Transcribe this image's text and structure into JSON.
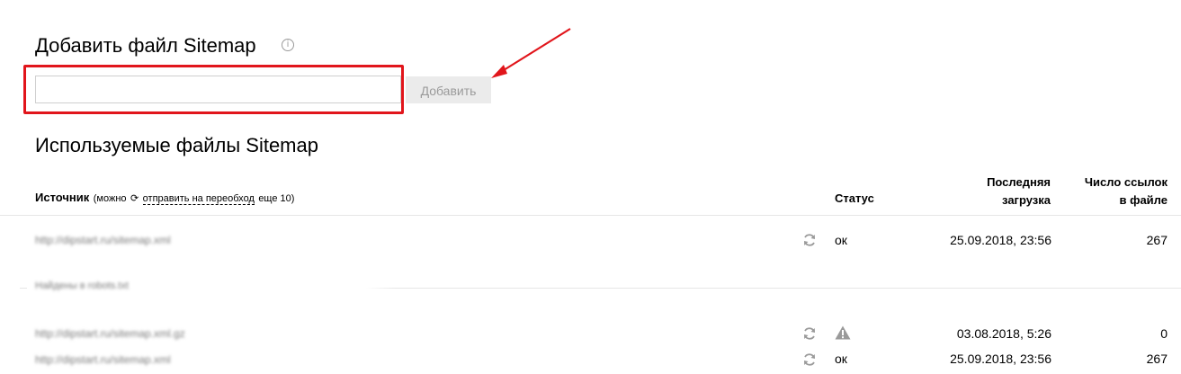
{
  "add_section": {
    "title": "Добавить файл Sitemap",
    "info_icon": "info-icon",
    "input_value": "",
    "add_button_label": "Добавить",
    "highlight_color": "#e1151b"
  },
  "used_section": {
    "title": "Используемые файлы Sitemap"
  },
  "table": {
    "headers": {
      "source": "Источник",
      "source_note_prefix": "(можно",
      "recrawl_link": "отправить на переобход",
      "source_note_suffix": "еще 10)",
      "status": "Статус",
      "last_load_line1": "Последняя",
      "last_load_line2": "загрузка",
      "links_count_line1": "Число ссылок",
      "links_count_line2": "в файле"
    },
    "rows": [
      {
        "url": "http://dipstart.ru/sitemap.xml",
        "status": "ок",
        "date": "25.09.2018, 23:56",
        "count": "267"
      }
    ],
    "robots_group": {
      "label": "Найдены в robots.txt",
      "rows": [
        {
          "url": "http://dipstart.ru/sitemap.xml.gz",
          "status_icon": "warning-icon",
          "date": "03.08.2018, 5:26",
          "count": "0"
        },
        {
          "url": "http://dipstart.ru/sitemap.xml",
          "status": "ок",
          "date": "25.09.2018, 23:56",
          "count": "267"
        }
      ]
    }
  },
  "colors": {
    "accent_red": "#e1151b",
    "button_bg": "#ebebeb",
    "muted": "#9a9a9a"
  }
}
